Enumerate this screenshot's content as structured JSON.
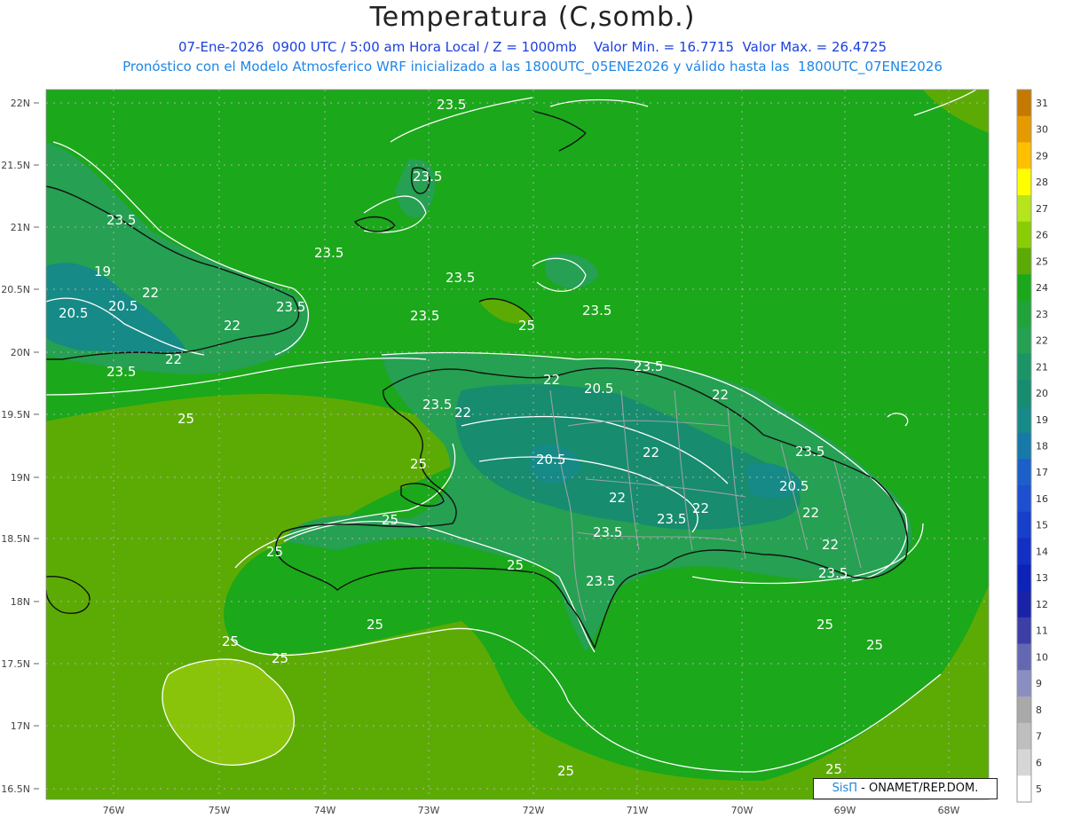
{
  "header": {
    "title": "Temperatura (C,somb.)",
    "line1": "07-Ene-2026  0900 UTC / 5:00 am Hora Local / Z = 1000mb    Valor Min. = 16.7715  Valor Max. = 26.4725",
    "line2": "Pronóstico con el Modelo Atmosferico WRF inicializado a las 1800UTC_05ENE2026 y válido hasta las  1800UTC_07ENE2026"
  },
  "map": {
    "lat_labels": [
      "22N",
      "21.5N",
      "21N",
      "20.5N",
      "20N",
      "19.5N",
      "19N",
      "18.5N",
      "18N",
      "17.5N",
      "17N",
      "16.5N"
    ],
    "lon_labels": [
      "76W",
      "75W",
      "74W",
      "73W",
      "72W",
      "71W",
      "70W",
      "69W",
      "68W"
    ],
    "contour_labels": [
      "23.5",
      "25",
      "22",
      "20.5",
      "19"
    ],
    "colors": {
      "ocean_23_24": "#1ba81b",
      "warm_24_25": "#5cab05",
      "warm_25_26": "#8ac40a",
      "land_22_23": "#26a052",
      "land_20_22": "#178c6e",
      "cold_19_20": "#168a86"
    }
  },
  "colorbar": {
    "labels": [
      "31",
      "30",
      "29",
      "28",
      "27",
      "26",
      "25",
      "24",
      "23",
      "22",
      "21",
      "20",
      "19",
      "18",
      "17",
      "16",
      "15",
      "14",
      "13",
      "12",
      "11",
      "10",
      "9",
      "8",
      "7",
      "6",
      "5"
    ],
    "colors": [
      "#c47a00",
      "#e69a00",
      "#ffc000",
      "#ffff00",
      "#b5e61d",
      "#8acd06",
      "#5cab05",
      "#1ba81b",
      "#1fa33a",
      "#26a052",
      "#1b9565",
      "#178c6e",
      "#168a86",
      "#1679a8",
      "#1c5fc8",
      "#1d4fd0",
      "#173fc9",
      "#1230c4",
      "#0d22b8",
      "#1a23a8",
      "#3b3fa6",
      "#6468b2",
      "#8a8ec0",
      "#a9a9a9",
      "#bebebe",
      "#d6d6d6",
      "#ffffff"
    ]
  },
  "credit": {
    "brand": "SisΠ",
    "text": "- ONAMET/REP.DOM."
  }
}
